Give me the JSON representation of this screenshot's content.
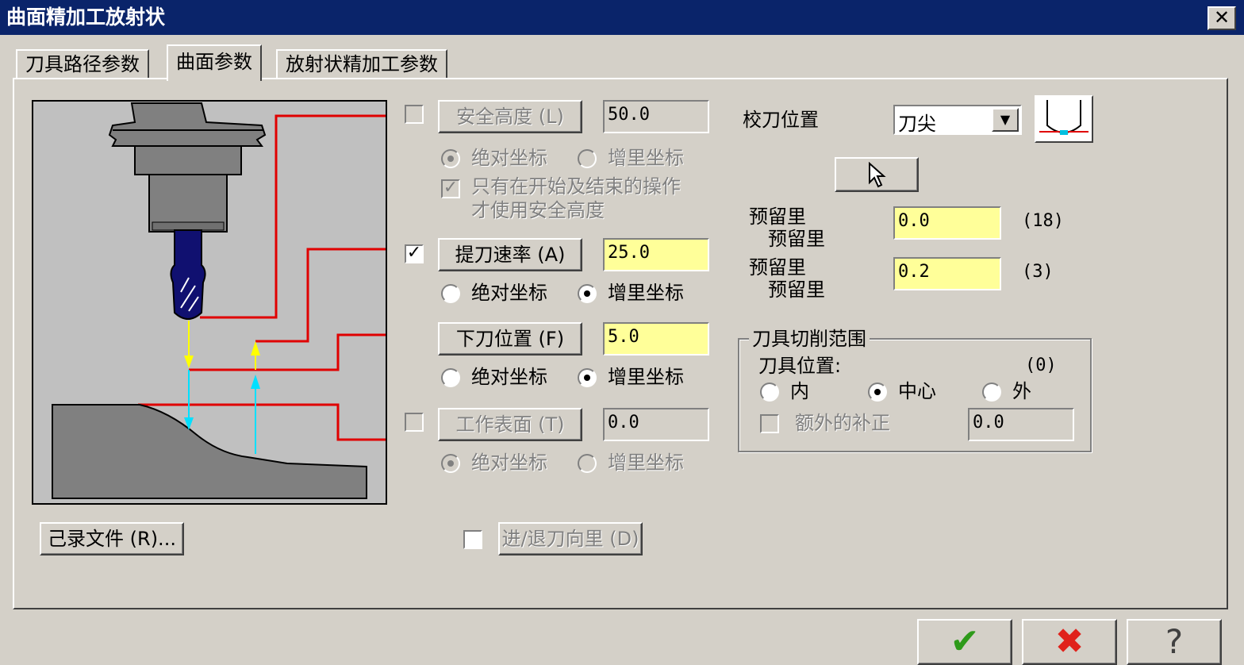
{
  "window": {
    "title": "曲面精加工放射状",
    "close_glyph": "✕"
  },
  "tabs": [
    {
      "label": "刀具路径参数"
    },
    {
      "label": "曲面参数"
    },
    {
      "label": "放射状精加工参数"
    }
  ],
  "clearance": {
    "label": "安全高度 (L)",
    "value": "50.0",
    "checked": false,
    "abs_label": "绝对坐标",
    "inc_label": "增里坐标",
    "only_label_1": "只有在开始及结束的操作",
    "only_label_2": "才使用安全高度"
  },
  "retract": {
    "label": "提刀速率 (A)",
    "value": "25.0",
    "checked": true,
    "abs_label": "绝对坐标",
    "inc_label": "增里坐标"
  },
  "feed_plane": {
    "label": "下刀位置 (F)",
    "value": "5.0",
    "abs_label": "绝对坐标",
    "inc_label": "增里坐标"
  },
  "top_of_stock": {
    "label": "工作表面 (T)",
    "value": "0.0",
    "checked": false,
    "abs_label": "绝对坐标",
    "inc_label": "增里坐标"
  },
  "tip_comp": {
    "label": "校刀位置",
    "value": "刀尖"
  },
  "stock": [
    {
      "line1": "预留里",
      "line2": "预留里",
      "value": "0.0",
      "count": "(18)"
    },
    {
      "line1": "预留里",
      "line2": "预留里",
      "value": "0.2",
      "count": "(3)"
    }
  ],
  "containment": {
    "title": "刀具切削范围",
    "position_label": "刀具位置:",
    "count": "(0)",
    "inside": "内",
    "center": "中心",
    "outside": "外",
    "extra_label": "额外的补正",
    "extra_value": "0.0"
  },
  "record_file_button": "己录文件 (R)...",
  "entry_exit": {
    "label": "进/退刀向里 (D)",
    "checked": false
  },
  "footer": {
    "ok_glyph": "✔",
    "cancel_glyph": "✖",
    "help_glyph": "?"
  },
  "colors": {
    "title_bar": "#0a246a",
    "dialog": "#d4d0c8",
    "field_highlight": "#ffff99",
    "ok": "#2e9a1a",
    "cancel": "#e0221b"
  }
}
